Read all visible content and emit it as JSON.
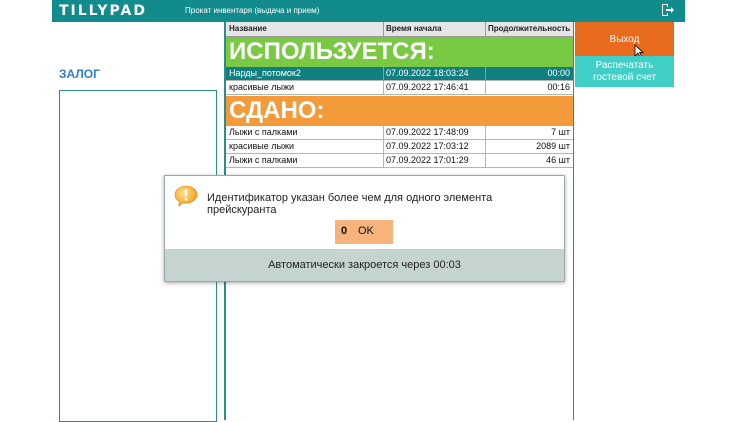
{
  "app": {
    "logo": "TILLYPAD",
    "title": "Прокат инвентаря (выдача и прием)",
    "icons": {
      "exit": "exit-icon"
    }
  },
  "left": {
    "deposit_label": "ЗАЛОГ"
  },
  "table": {
    "columns": [
      "Название",
      "Время начала",
      "Продолжительность"
    ],
    "section_used": "ИСПОЛЬЗУЕТСЯ:",
    "section_returned": "СДАНО:",
    "used_rows": [
      {
        "name": "Нарды_потомок2",
        "time": "07.09.2022 18:03:24",
        "duration": "00:00",
        "selected": true
      },
      {
        "name": "красивые лыжи",
        "time": "07.09.2022 17:46:41",
        "duration": "00:16",
        "selected": false
      }
    ],
    "returned_rows": [
      {
        "name": "Лыжи с палками",
        "time": "07.09.2022 17:48:09",
        "duration": "7 шт"
      },
      {
        "name": "красивые лыжи",
        "time": "07.09.2022 17:03:12",
        "duration": "2089 шт"
      },
      {
        "name": "Лыжи с палками",
        "time": "07.09.2022 17:01:29",
        "duration": "46 шт"
      }
    ]
  },
  "right": {
    "exit_label": "Выход",
    "print_label": "Распечатать гостевой счет"
  },
  "dialog": {
    "message": "Идентификатор указан более чем для одного элемента прейскуранта",
    "ok_key": "0",
    "ok_label": "OK",
    "footer": "Автоматически закроется через 00:03",
    "icon": "warning-bubble-icon"
  },
  "colors": {
    "titlebar": "#118b8b",
    "used": "#7ac943",
    "returned": "#f39a3b",
    "exit_button": "#e86a1c",
    "print_button": "#3fcfc6",
    "ok_button": "#f7b37c"
  }
}
